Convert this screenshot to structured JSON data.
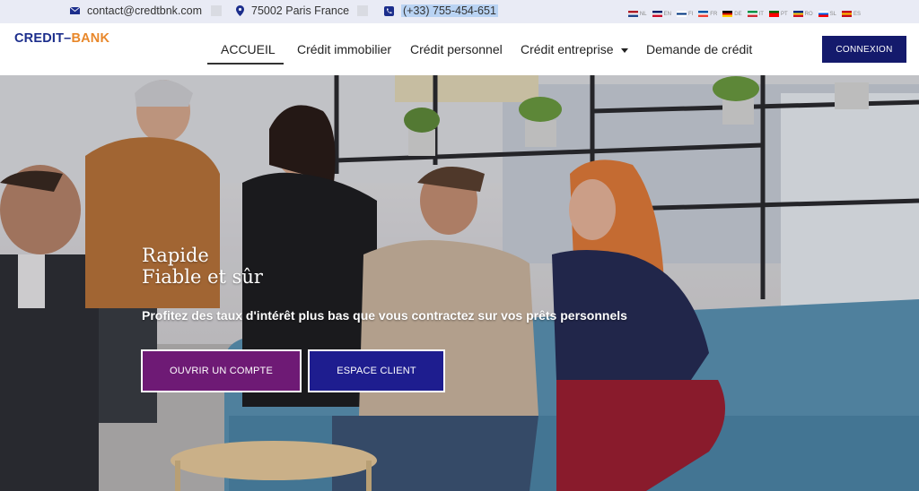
{
  "topbar": {
    "email": "contact@credtbnk.com",
    "address": "75002 Paris France",
    "phone": "(+33) 755-454-651",
    "languages": [
      {
        "code": "NL",
        "colors": [
          "#ae1c28",
          "#ffffff",
          "#21468b"
        ]
      },
      {
        "code": "EN",
        "colors": [
          "#012169",
          "#ffffff",
          "#c8102e"
        ]
      },
      {
        "code": "FI",
        "colors": [
          "#ffffff",
          "#003580",
          "#ffffff"
        ]
      },
      {
        "code": "FR",
        "colors": [
          "#0055a4",
          "#ffffff",
          "#ef4135"
        ]
      },
      {
        "code": "DE",
        "colors": [
          "#000000",
          "#dd0000",
          "#ffce00"
        ]
      },
      {
        "code": "IT",
        "colors": [
          "#009246",
          "#ffffff",
          "#ce2b37"
        ]
      },
      {
        "code": "PT",
        "colors": [
          "#006600",
          "#ff0000",
          "#ff0000"
        ]
      },
      {
        "code": "RO",
        "colors": [
          "#002b7f",
          "#fcd116",
          "#ce1126"
        ]
      },
      {
        "code": "SL",
        "colors": [
          "#ffffff",
          "#005ce6",
          "#ff0000"
        ]
      },
      {
        "code": "ES",
        "colors": [
          "#c60b1e",
          "#ffc400",
          "#c60b1e"
        ]
      }
    ]
  },
  "header": {
    "logo_part1": "CREDIT",
    "logo_dash": "–",
    "logo_part2": "BANK",
    "nav": [
      "ACCUEIL",
      "Crédit immobilier",
      "Crédit personnel",
      "Crédit entreprise",
      "Demande de crédit"
    ],
    "login_label": "CONNEXION"
  },
  "hero": {
    "title_line1": "Rapide",
    "title_line2": "Fiable et sûr",
    "subtitle": "Profitez des taux d'intérêt plus bas que vous contractez sur vos prêts personnels",
    "btn_open": "OUVRIR UN COMPTE",
    "btn_client": "ESPACE CLIENT"
  },
  "colors": {
    "brand_blue": "#141a6c",
    "brand_orange": "#e8872a",
    "btn_purple": "#6e1a75",
    "btn_blue": "#1e1d8f"
  }
}
